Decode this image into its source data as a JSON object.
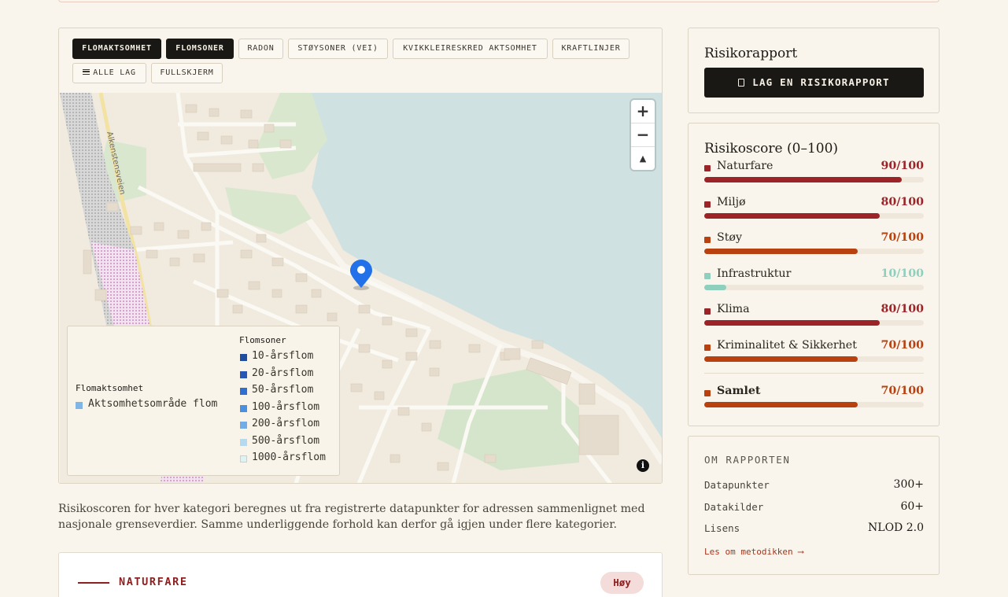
{
  "map": {
    "layers": [
      {
        "label": "FLOMAKTSOMHET",
        "active": true
      },
      {
        "label": "FLOMSONER",
        "active": true
      },
      {
        "label": "RADON",
        "active": false
      },
      {
        "label": "STØYSONER (VEI)",
        "active": false
      },
      {
        "label": "KVIKKLEIRESKRED AKTSOMHET",
        "active": false
      },
      {
        "label": "KRAFTLINJER",
        "active": false
      }
    ],
    "all_layers_label": "ALLE LAG",
    "fullscreen_label": "FULLSKJERM",
    "zoom_in": "+",
    "zoom_out": "−",
    "compass": "▲",
    "info": "i",
    "street_labels": [
      "Alkenstensveien"
    ],
    "legend": {
      "flomaktsomhet_title": "Flomaktsomhet",
      "flomaktsomhet_item": "Aktsomhetsområde flom",
      "flomaktsomhet_color": "#7fb6e6",
      "flomsoner_title": "Flomsoner",
      "flomsoner_items": [
        {
          "label": "10-årsflom",
          "color": "#1f4ea1"
        },
        {
          "label": "20-årsflom",
          "color": "#2756b4"
        },
        {
          "label": "50-årsflom",
          "color": "#2f6fd1"
        },
        {
          "label": "100-årsflom",
          "color": "#4a90e0"
        },
        {
          "label": "200-årsflom",
          "color": "#72ace6"
        },
        {
          "label": "500-årsflom",
          "color": "#b7d9ef"
        },
        {
          "label": "1000-årsflom",
          "color": "#dff2f4"
        }
      ]
    }
  },
  "caption": "Risikoscoren for hver kategori beregnes ut fra registrerte datapunkter for adressen sammenlignet med nasjonale grenseverdier. Samme underliggende forhold kan derfor gå igjen under flere kategorier.",
  "naturfare_section": {
    "title": "NATURFARE",
    "badge": "Høy"
  },
  "risikorapport": {
    "title": "Risikorapport",
    "button": "LAG EN RISIKORAPPORT"
  },
  "risikoscore": {
    "title": "Risikoscore (0–100)",
    "items": [
      {
        "label": "Naturfare",
        "value": "90/100",
        "score": 90,
        "color": "#9c2328"
      },
      {
        "label": "Miljø",
        "value": "80/100",
        "score": 80,
        "color": "#9c2328"
      },
      {
        "label": "Støy",
        "value": "70/100",
        "score": 70,
        "color": "#b8410f"
      },
      {
        "label": "Infrastruktur",
        "value": "10/100",
        "score": 10,
        "color": "#8fcfbe"
      },
      {
        "label": "Klima",
        "value": "80/100",
        "score": 80,
        "color": "#9c2328"
      },
      {
        "label": "Kriminalitet & Sikkerhet",
        "value": "70/100",
        "score": 70,
        "color": "#b8410f"
      }
    ],
    "total": {
      "label": "Samlet",
      "value": "70/100",
      "score": 70,
      "color": "#b8410f"
    }
  },
  "about": {
    "title": "OM RAPPORTEN",
    "rows": [
      {
        "key": "Datapunkter",
        "value": "300+"
      },
      {
        "key": "Datakilder",
        "value": "60+"
      },
      {
        "key": "Lisens",
        "value": "NLOD 2.0"
      }
    ],
    "link": "Les om metodikken ⟶"
  }
}
